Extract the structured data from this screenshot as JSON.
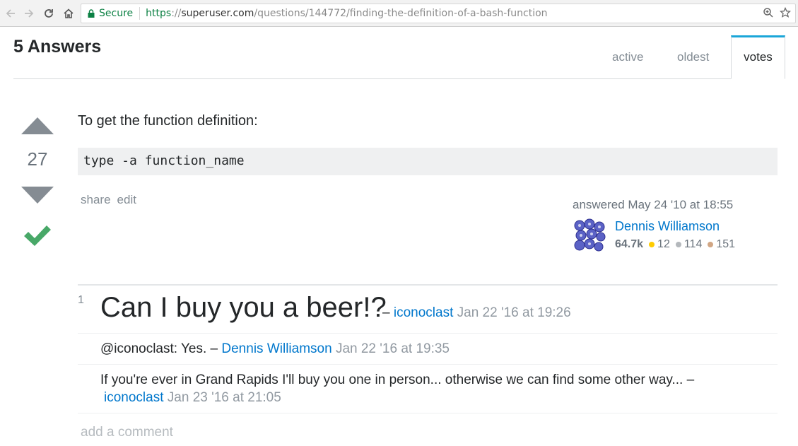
{
  "browser": {
    "secure_label": "Secure",
    "url_scheme": "https",
    "url_sep": "://",
    "url_host": "superuser.com",
    "url_path": "/questions/144772/finding-the-definition-of-a-bash-function"
  },
  "answers": {
    "title": "5 Answers",
    "tabs": [
      {
        "label": "active",
        "active": false
      },
      {
        "label": "oldest",
        "active": false
      },
      {
        "label": "votes",
        "active": true
      }
    ]
  },
  "post": {
    "vote_count": "27",
    "accepted": true,
    "text": "To get the function definition:",
    "code": "type -a function_name",
    "menu": {
      "share": "share",
      "edit": "edit"
    },
    "signature": {
      "action": "answered May 24 '10 at 18:55",
      "user_name": "Dennis Williamson",
      "reputation": "64.7k",
      "badges": {
        "gold": "12",
        "silver": "114",
        "bronze": "151"
      },
      "badge_colors": {
        "gold": "#ffcc01",
        "silver": "#b4b8bc",
        "bronze": "#d1a684"
      }
    }
  },
  "comments": [
    {
      "score": "1",
      "text": "Can I buy you a beer!?",
      "dash": " – ",
      "user": "iconoclast",
      "date": "Jan 22 '16 at 19:26"
    },
    {
      "text": "@iconoclast: Yes.",
      "dash": " – ",
      "user": "Dennis Williamson",
      "date": "Jan 22 '16 at 19:35"
    },
    {
      "text": "If you're ever in Grand Rapids I'll buy you one in person... otherwise we can find some other way...",
      "dash": " –",
      "user": "iconoclast",
      "date": "Jan 23 '16 at 21:05"
    }
  ],
  "add_comment": "add a comment",
  "colors": {
    "accent": "#1aa6d8",
    "link": "#0077cc",
    "accepted": "#48a868",
    "vote_arrow": "#858c93"
  }
}
